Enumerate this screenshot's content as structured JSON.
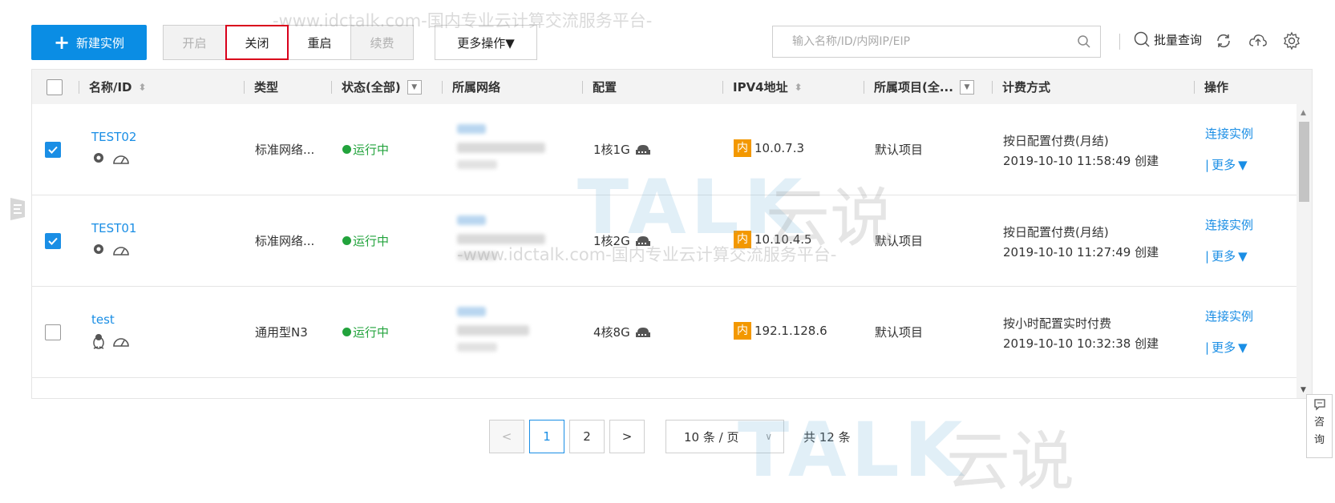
{
  "toolbar": {
    "new_instance": "新建实例",
    "start": "开启",
    "close": "关闭",
    "restart": "重启",
    "renew": "续费",
    "more_ops": "更多操作▼",
    "search_placeholder": "输入名称/ID/内网IP/EIP",
    "batch_query": "批量查询"
  },
  "table": {
    "columns": {
      "name_id": "名称/ID",
      "type": "类型",
      "status": "状态(全部)",
      "network": "所属网络",
      "config": "配置",
      "ipv4": "IPV4地址",
      "project": "所属项目(全...",
      "billing": "计费方式",
      "actions": "操作"
    },
    "rows": [
      {
        "checked": true,
        "name": "TEST02",
        "type": "标准网络...",
        "status": "运行中",
        "config": "1核1G",
        "ip_tag": "内",
        "ip": "10.0.7.3",
        "project": "默认项目",
        "billing_mode": "按日配置付费(月结)",
        "created": "2019-10-10 11:58:49 创建",
        "action_connect": "连接实例",
        "action_more": "更多"
      },
      {
        "checked": true,
        "name": "TEST01",
        "type": "标准网络...",
        "status": "运行中",
        "config": "1核2G",
        "ip_tag": "内",
        "ip": "10.10.4.5",
        "project": "默认项目",
        "billing_mode": "按日配置付费(月结)",
        "created": "2019-10-10 11:27:49 创建",
        "action_connect": "连接实例",
        "action_more": "更多"
      },
      {
        "checked": false,
        "name": "test",
        "type": "通用型N3",
        "status": "运行中",
        "config": "4核8G",
        "ip_tag": "内",
        "ip": "192.1.128.6",
        "project": "默认项目",
        "billing_mode": "按小时配置实时付费",
        "created": "2019-10-10 10:32:38 创建",
        "action_connect": "连接实例",
        "action_more": "更多"
      }
    ]
  },
  "pagination": {
    "page1": "1",
    "page2": "2",
    "page_size": "10 条 / 页",
    "total": "共 12 条"
  },
  "watermark": {
    "line": "-www.idctalk.com-国内专业云计算交流服务平台-",
    "logo": "TALK",
    "logo_cn": "云说"
  },
  "consult": {
    "label_1": "咨",
    "label_2": "询"
  },
  "colors": {
    "primary": "#0a8de4",
    "link": "#1a8ee5",
    "running": "#22a33c",
    "inner_tag": "#f39800",
    "highlight_border": "#d9001b"
  }
}
